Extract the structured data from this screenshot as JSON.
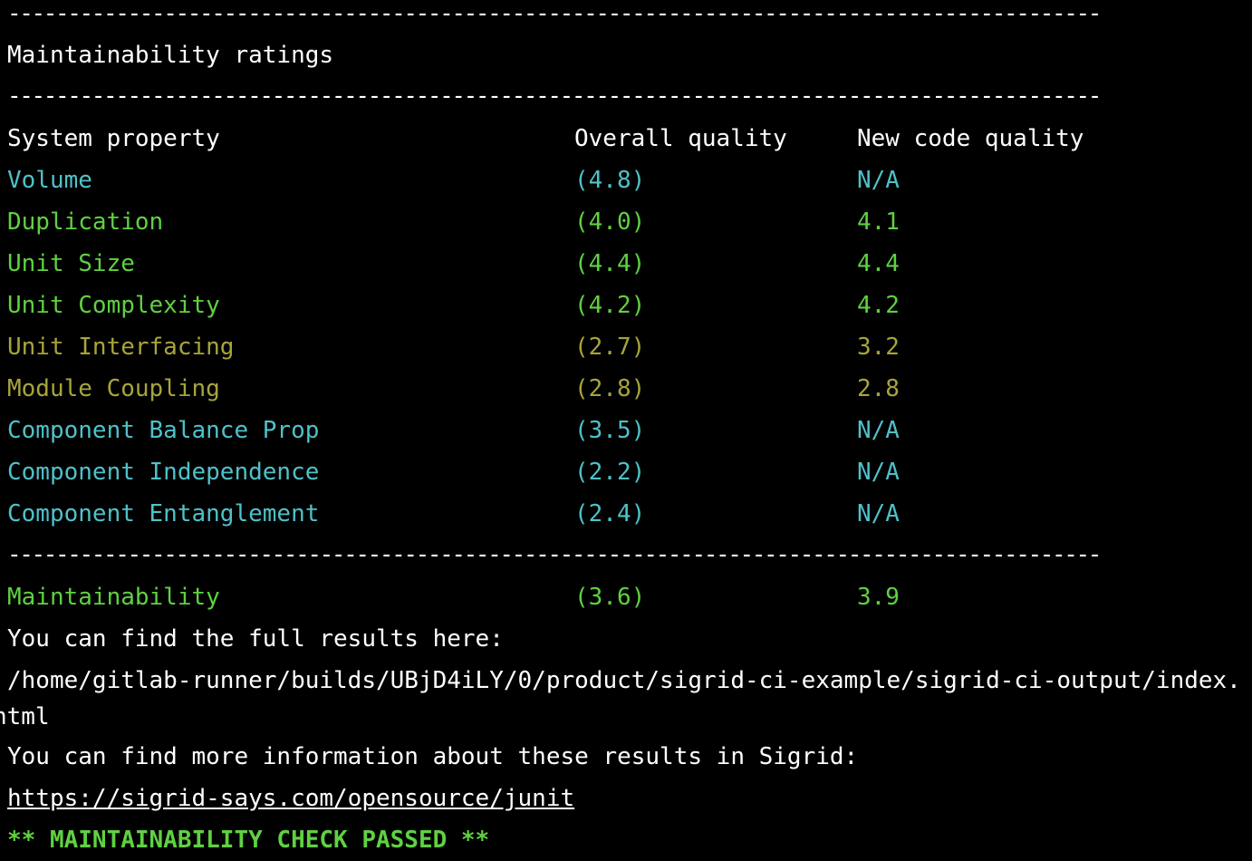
{
  "rule": "------------------------------------------------------------------------------------------------------",
  "heading": "Maintainability ratings",
  "table": {
    "headers": [
      "System property",
      "Overall quality",
      "New code quality"
    ],
    "rows": [
      {
        "property": "Volume",
        "overall": "(4.8)",
        "new_code": "N/A",
        "color": "#4fc1c9"
      },
      {
        "property": "Duplication",
        "overall": "(4.0)",
        "new_code": "4.1",
        "color": "#5fd141"
      },
      {
        "property": "Unit Size",
        "overall": "(4.4)",
        "new_code": "4.4",
        "color": "#5fd141"
      },
      {
        "property": "Unit Complexity",
        "overall": "(4.2)",
        "new_code": "4.2",
        "color": "#5fd141"
      },
      {
        "property": "Unit Interfacing",
        "overall": "(2.7)",
        "new_code": "3.2",
        "color": "#a8a43a"
      },
      {
        "property": "Module Coupling",
        "overall": "(2.8)",
        "new_code": "2.8",
        "color": "#a8a43a"
      },
      {
        "property": "Component Balance Prop",
        "overall": "(3.5)",
        "new_code": "N/A",
        "color": "#4fc1c9"
      },
      {
        "property": "Component Independence",
        "overall": "(2.2)",
        "new_code": "N/A",
        "color": "#4fc1c9"
      },
      {
        "property": "Component Entanglement",
        "overall": "(2.4)",
        "new_code": "N/A",
        "color": "#4fc1c9"
      }
    ],
    "total": {
      "property": "Maintainability",
      "overall": "(3.6)",
      "new_code": "3.9",
      "color": "#5fd141"
    }
  },
  "messages": {
    "full_results_label": "You can find the full results here:",
    "full_results_path_line1": "/home/gitlab-runner/builds/UBjD4iLY/0/product/sigrid-ci-example/sigrid-ci-output/index.",
    "full_results_path_line2": "html",
    "more_info_label": "You can find more information about these results in Sigrid:",
    "sigrid_link": "https://sigrid-says.com/opensource/junit",
    "status": "** MAINTAINABILITY CHECK PASSED **"
  }
}
